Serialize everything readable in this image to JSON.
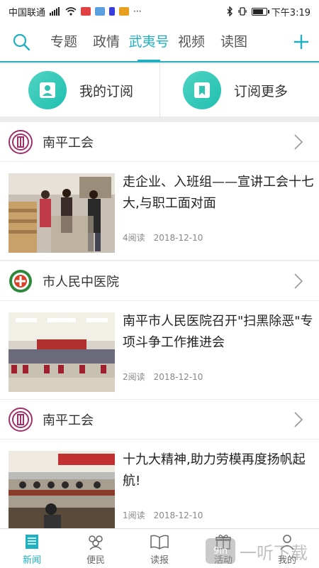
{
  "status": {
    "carrier": "中国联通",
    "network": "4G",
    "time": "下午3:19"
  },
  "nav": {
    "tabs": [
      {
        "label": "专题"
      },
      {
        "label": "政情"
      },
      {
        "label": "武夷号"
      },
      {
        "label": "视频"
      },
      {
        "label": "读图"
      }
    ],
    "active_tab": "武夷号"
  },
  "subscribe": {
    "my_label": "我的订阅",
    "more_label": "订阅更多"
  },
  "articles": [
    {
      "source": "南平工会",
      "title": "走企业、入班组——宣讲工会十七大,与职工面对面",
      "reads": "4阅读",
      "date": "2018-12-10"
    },
    {
      "source": "市人民中医院",
      "title": "南平市人民医院召开\"扫黑除恶\"专项斗争工作推进会",
      "reads": "2阅读",
      "date": "2018-12-10"
    },
    {
      "source": "南平工会",
      "title": "十九大精神,助力劳模再度扬帆起航!",
      "reads": "1阅读",
      "date": "2018-12-10"
    }
  ],
  "bottom_nav": {
    "items": [
      {
        "label": "新闻"
      },
      {
        "label": "便民"
      },
      {
        "label": "读报"
      },
      {
        "label": "活动"
      },
      {
        "label": "我的"
      }
    ]
  },
  "watermark": {
    "logo_text": "9in",
    "text": "一听下载"
  },
  "colors": {
    "accent": "#1fb0c2",
    "subscribe_circle": "#2fc4b2"
  }
}
